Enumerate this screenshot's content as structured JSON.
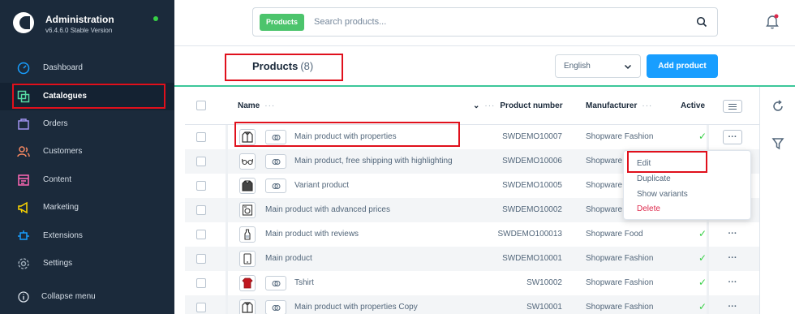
{
  "sidebar": {
    "title": "Administration",
    "version": "v6.4.6.0 Stable Version",
    "items": [
      {
        "label": "Dashboard",
        "icon": "dashboard-icon",
        "color": "#189eff"
      },
      {
        "label": "Catalogues",
        "icon": "catalogue-icon",
        "color": "#57d9a3"
      },
      {
        "label": "Orders",
        "icon": "orders-icon",
        "color": "#a092f0"
      },
      {
        "label": "Customers",
        "icon": "customers-icon",
        "color": "#f88962"
      },
      {
        "label": "Content",
        "icon": "content-icon",
        "color": "#ff68b4"
      },
      {
        "label": "Marketing",
        "icon": "marketing-icon",
        "color": "#ffd700"
      },
      {
        "label": "Extensions",
        "icon": "extensions-icon",
        "color": "#189eff"
      },
      {
        "label": "Settings",
        "icon": "settings-icon",
        "color": "#9aa8b5"
      }
    ],
    "collapse_label": "Collapse menu"
  },
  "search": {
    "tag": "Products",
    "placeholder": "Search products..."
  },
  "smartbar": {
    "title": "Products",
    "count": "(8)",
    "language": "English",
    "add_label": "Add product"
  },
  "grid": {
    "columns": {
      "name": "Name",
      "product_number": "Product number",
      "manufacturer": "Manufacturer",
      "active": "Active"
    },
    "rows": [
      {
        "name": "Main product with properties",
        "number": "SWDEMO10007",
        "manufacturer": "Shopware Fashion",
        "variant": true,
        "thumb": "jacket"
      },
      {
        "name": "Main product, free shipping with highlighting",
        "number": "SWDEMO10006",
        "manufacturer": "Shopware",
        "variant": true,
        "thumb": "glasses"
      },
      {
        "name": "Variant product",
        "number": "SWDEMO10005",
        "manufacturer": "Shopware",
        "variant": true,
        "thumb": "jacket"
      },
      {
        "name": "Main product with advanced prices",
        "number": "SWDEMO10002",
        "manufacturer": "Shopware",
        "variant": false,
        "thumb": "machine"
      },
      {
        "name": "Main product with reviews",
        "number": "SWDEMO100013",
        "manufacturer": "Shopware Food",
        "variant": false,
        "thumb": "bottle"
      },
      {
        "name": "Main product",
        "number": "SWDEMO10001",
        "manufacturer": "Shopware Fashion",
        "variant": false,
        "thumb": "phone"
      },
      {
        "name": "Tshirt",
        "number": "SW10002",
        "manufacturer": "Shopware Fashion",
        "variant": true,
        "thumb": "shirt"
      },
      {
        "name": "Main product with properties Copy",
        "number": "SW10001",
        "manufacturer": "Shopware Fashion",
        "variant": true,
        "thumb": "jacket"
      }
    ]
  },
  "context_menu": {
    "edit": "Edit",
    "duplicate": "Duplicate",
    "show_variants": "Show variants",
    "delete": "Delete"
  },
  "colors": {
    "sidebar_bg": "#1b2a3b",
    "primary": "#189eff",
    "success": "#37d046",
    "danger": "#de294c",
    "highlight": "#e0101c"
  }
}
